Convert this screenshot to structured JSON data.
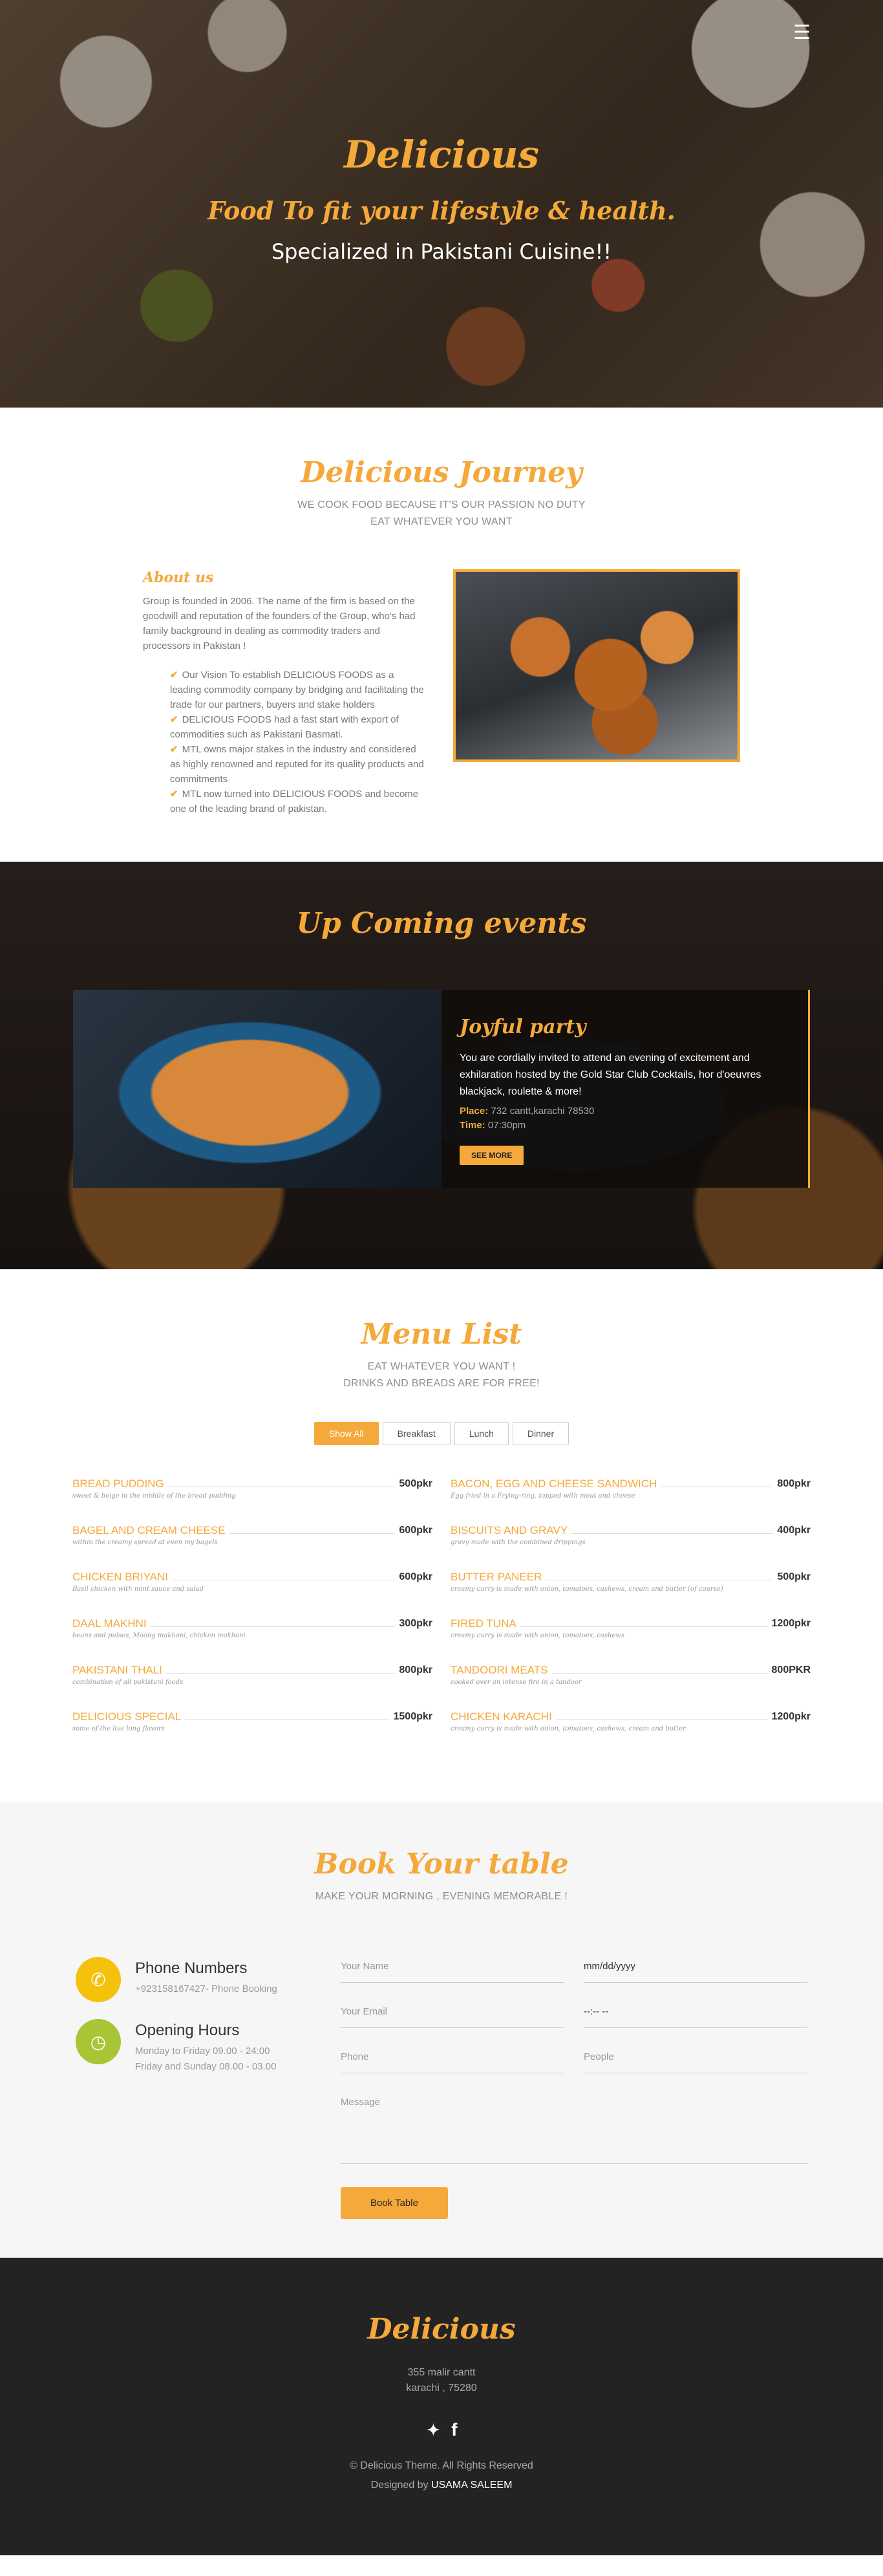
{
  "hero": {
    "title": "Delicious",
    "tagline": "Food To fit your lifestyle & health.",
    "specialty": "Specialized in Pakistani Cuisine!!",
    "menu_icon": "hamburger-menu-icon"
  },
  "journey": {
    "title": "Delicious Journey",
    "subtitle_1": "WE COOK FOOD BECAUSE IT'S OUR PASSION NO DUTY",
    "subtitle_2": "EAT WHATEVER YOU WANT",
    "about_title": "About us",
    "about_text": "Group is founded in 2006. The name of the firm is based on the goodwill and reputation of the founders of the Group, who's had family background in dealing as commodity traders and processors in Pakistan !",
    "points": [
      "Our Vision To establish DELICIOUS FOODS as a leading commodity company by bridging and facilitating the trade for our partners, buyers and stake holders",
      "DELICIOUS FOODS had a fast start with export of commodities such as Pakistani Basmati.",
      "MTL owns major stakes in the industry and considered as highly renowned and reputed for its quality products and commitments",
      "MTL now turned into DELICIOUS FOODS and become one of the leading brand of pakistan."
    ]
  },
  "events": {
    "title": "Up Coming events",
    "event_title": "Joyful party",
    "event_text": "You are cordially invited to attend an evening of excitement and exhilaration hosted by the Gold Star Club Cocktails, hor d'oeuvres blackjack, roulette & more!",
    "place_label": "Place:",
    "place_value": "732 cantt,karachi 78530",
    "time_label": "Time:",
    "time_value": "07:30pm",
    "button": "SEE MORE"
  },
  "menu": {
    "title": "Menu List",
    "subtitle_1": "EAT WHATEVER YOU WANT !",
    "subtitle_2": "DRINKS AND BREADS ARE FOR FREE!",
    "filters": [
      "Show All",
      "Breakfast",
      "Lunch",
      "Dinner"
    ],
    "items": [
      {
        "name": "BREAD PUDDING",
        "price": "500pkr",
        "desc": "sweet & beige in the middle of the bread pudding"
      },
      {
        "name": "BACON, EGG AND CHEESE SANDWICH",
        "price": "800pkr",
        "desc": "Egg fried in a Frying-ring, topped with meat and cheese"
      },
      {
        "name": "BAGEL AND CREAM CHEESE",
        "price": "600pkr",
        "desc": "within the creamy spread at even my bagels"
      },
      {
        "name": "BISCUITS AND GRAVY",
        "price": "400pkr",
        "desc": "gravy made with the combined drippings"
      },
      {
        "name": "CHICKEN BRIYANI",
        "price": "600pkr",
        "desc": "Basil chicken with mint sauce and salad"
      },
      {
        "name": "BUTTER PANEER",
        "price": "500pkr",
        "desc": "creamy curry is made with onion, tomatoes, cashews, cream and butter (of course)"
      },
      {
        "name": "DAAL MAKHNI",
        "price": "300pkr",
        "desc": "beans and pulses, Moong makhani, chicken makhani"
      },
      {
        "name": "FIRED TUNA",
        "price": "1200pkr",
        "desc": "creamy curry is made with onion, tomatoes, cashews"
      },
      {
        "name": "PAKISTANI THALI",
        "price": "800pkr",
        "desc": "combination of all pakistani foods"
      },
      {
        "name": "TANDOORI MEATS",
        "price": "800PKR",
        "desc": "cooked over an intense fire in a tandoor"
      },
      {
        "name": "DELICIOUS SPECIAL",
        "price": "1500pkr",
        "desc": "some of the live long flavors"
      },
      {
        "name": "CHICKEN KARACHI",
        "price": "1200pkr",
        "desc": "creamy curry is made with onion, tomatoes, cashews, cream and butter"
      }
    ]
  },
  "book": {
    "title": "Book Your table",
    "subtitle": "MAKE YOUR MORNING , EVENING MEMORABLE !",
    "phone_title": "Phone Numbers",
    "phone_text": "+923158167427- Phone Booking",
    "hours_title": "Opening Hours",
    "hours_1": "Monday to Friday 09.00 - 24:00",
    "hours_2": "Friday and Sunday 08.00 - 03.00",
    "name_ph": "Your Name",
    "date_ph": "mm/dd/yyyy",
    "email_ph": "Your Email",
    "time_ph": "--:-- --",
    "phone_ph": "Phone",
    "people_ph": "People",
    "message_ph": "Message",
    "button": "Book Table",
    "phone_color": "#f4c20d",
    "hours_color": "#a8c536"
  },
  "footer": {
    "logo": "Delicious",
    "address_1": "355 malir cantt",
    "address_2": "karachi , 75280",
    "copyright": "© Delicious Theme. All Rights Reserved",
    "designed_by": "Designed by",
    "designer": "USAMA SALEEM"
  },
  "colors": {
    "accent": "#f4a93a",
    "dark": "#232323"
  }
}
